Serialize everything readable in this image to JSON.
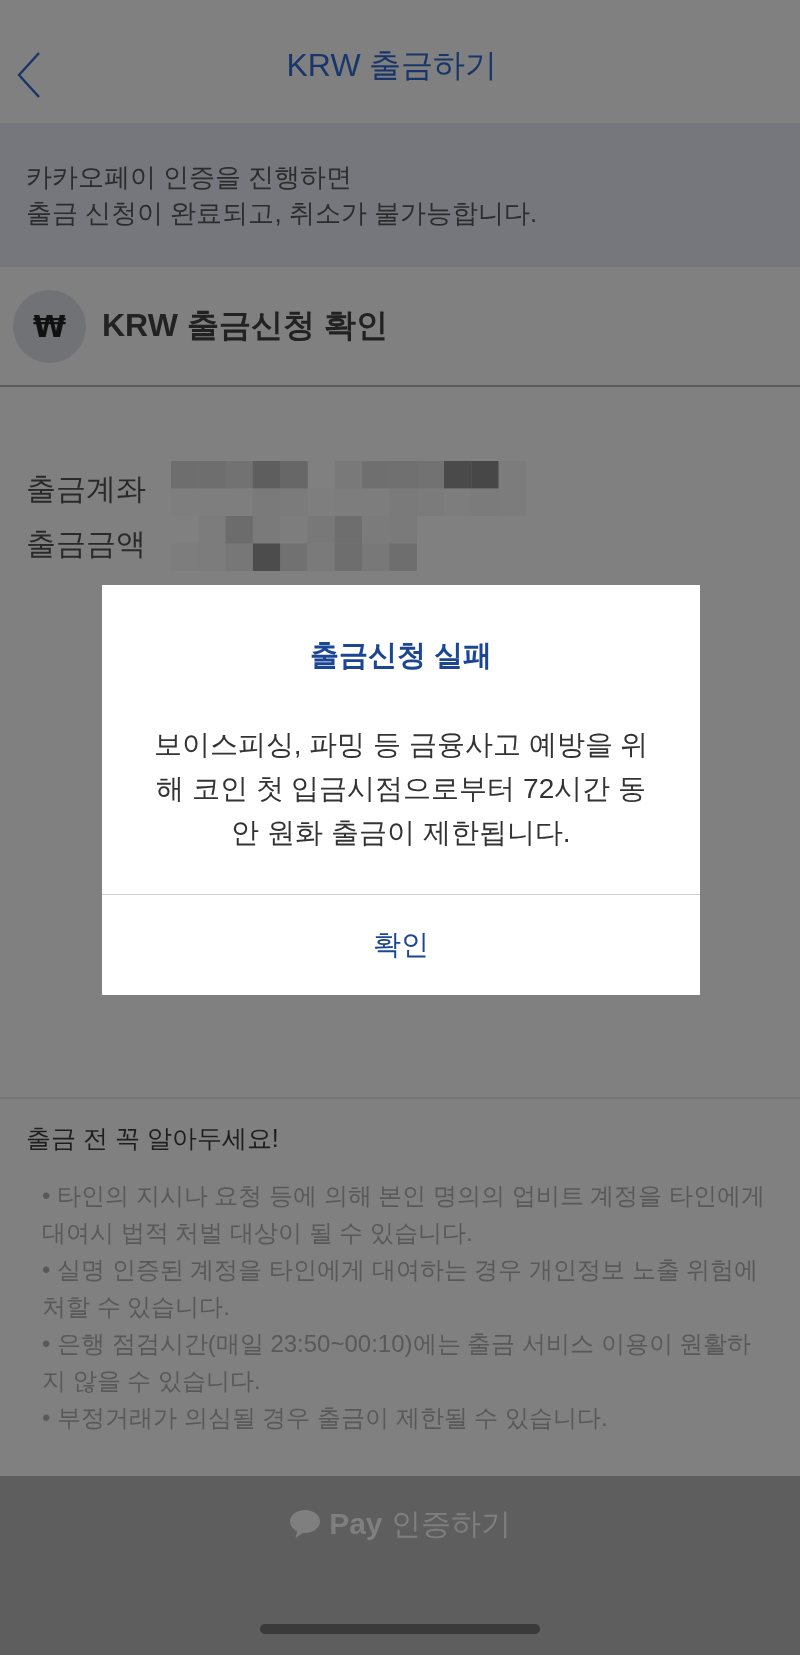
{
  "header": {
    "title": "KRW 출금하기"
  },
  "banner": {
    "text": "카카오페이 인증을 진행하면\n출금 신청이 완료되고, 취소가 불가능합니다."
  },
  "confirm": {
    "symbol": "₩",
    "title": "KRW 출금신청 확인"
  },
  "details": [
    {
      "label": "출금계좌"
    },
    {
      "label": "출금금액"
    }
  ],
  "dialog": {
    "title": "출금신청 실패",
    "message": "보이스피싱, 파밍 등 금융사고 예방을 위해 코인 첫 입금시점으로부터 72시간 동안 원화 출금이 제한됩니다.",
    "button": "확인"
  },
  "notes": {
    "title": "출금 전 꼭 알아두세요!",
    "items": [
      "• 타인의 지시나 요청 등에 의해 본인 명의의 업비트 계정을 타인에게 대여시 법적 처벌 대상이 될 수 있습니다.",
      "• 실명 인증된 계정을 타인에게 대여하는 경우 개인정보 노출 위험에 처할 수 있습니다.",
      "• 은행 점검시간(매일 23:50~00:10)에는 출금 서비스 이용이 원활하지 않을 수 있습니다.",
      "• 부정거래가 의심될 경우 출금이 제한될 수 있습니다."
    ]
  },
  "action_button": {
    "label": "**Pay** 인증하기",
    "disabled": true
  }
}
